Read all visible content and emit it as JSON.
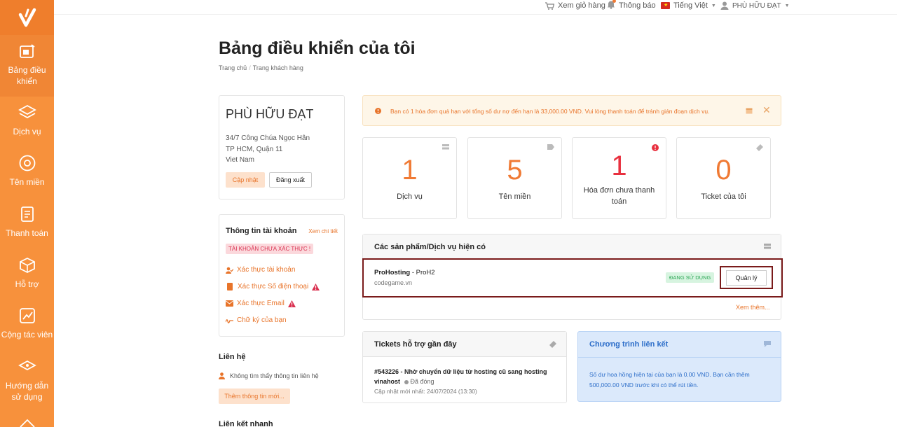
{
  "topbar": {
    "cart": "Xem giỏ hàng",
    "notifications": "Thông báo",
    "language": "Tiếng Việt",
    "user": "PHÙ HỮU ĐẠT"
  },
  "sidebar": {
    "items": [
      {
        "label": "Bảng điều khiển",
        "icon": "dashboard-icon"
      },
      {
        "label": "Dịch vụ",
        "icon": "layers-icon"
      },
      {
        "label": "Tên miền",
        "icon": "globe-icon"
      },
      {
        "label": "Thanh toán",
        "icon": "invoice-icon"
      },
      {
        "label": "Hỗ trợ",
        "icon": "support-icon"
      },
      {
        "label": "Cộng tác viên",
        "icon": "affiliate-icon"
      },
      {
        "label": "Hướng dẫn sử dụng",
        "icon": "guide-icon"
      }
    ]
  },
  "page": {
    "title": "Bảng điều khiển của tôi",
    "breadcrumb": [
      "Trang chủ",
      "Trang khách hàng"
    ]
  },
  "profile": {
    "name": "PHÙ HỮU ĐẠT",
    "address_line1": "34/7 Công Chúa Ngọc Hân",
    "address_line2": "TP HCM, Quận 11",
    "address_line3": "Viet Nam",
    "update_label": "Cập nhật",
    "logout_label": "Đăng xuất"
  },
  "account": {
    "title": "Thông tin tài khoản",
    "details_link": "Xem chi tiết",
    "unverified_badge": "TÀI KHOẢN CHƯA XÁC THỰC !",
    "links": [
      "Xác thực tài khoản",
      "Xác thực Số điện thoại",
      "Xác thực Email",
      "Chữ ký của bạn"
    ]
  },
  "contact": {
    "title": "Liên hệ",
    "empty_text": "Không tìm thấy thông tin liên hệ",
    "add_label": "Thêm thông tin mới..."
  },
  "quicklinks": {
    "title": "Liên kết nhanh"
  },
  "alert": {
    "text": "Bạn có 1 hóa đơn quá hạn với tổng số dư nợ đến hạn là 33,000.00 VND. Vui lòng thanh toán để tránh gián đoạn dịch vụ."
  },
  "stats": [
    {
      "value": "1",
      "label": "Dịch vụ"
    },
    {
      "value": "5",
      "label": "Tên miền"
    },
    {
      "value": "1",
      "label": "Hóa đơn chưa thanh toán"
    },
    {
      "value": "0",
      "label": "Ticket của tôi"
    }
  ],
  "products": {
    "title": "Các sản phẩm/Dịch vụ hiện có",
    "item_name": "ProHosting",
    "item_plan": " - ProH2",
    "item_domain": "codegame.vn",
    "status": "ĐANG SỬ DỤNG",
    "manage_label": "Quản lý",
    "see_more": "Xem thêm..."
  },
  "tickets": {
    "title": "Tickets hỗ trợ gần đây",
    "item_title": "#543226 - Nhờ chuyển dữ liệu từ hosting cũ sang hosting vinahost",
    "item_status": "Đã đóng",
    "item_updated": "Cập nhật mới nhất: 24/07/2024 (13:30)"
  },
  "affiliate": {
    "title": "Chương trình liên kết",
    "text": "Số dư hoa hồng hiện tại của bạn là 0.00 VND. Bạn cần thêm 500,000.00 VND trước khi có thể rút tiền."
  },
  "colors": {
    "sidebar": "#f7913c",
    "accent": "#e8742a",
    "highlight_border": "#7a1b1b",
    "affiliate_bg": "#dbe9fb"
  }
}
